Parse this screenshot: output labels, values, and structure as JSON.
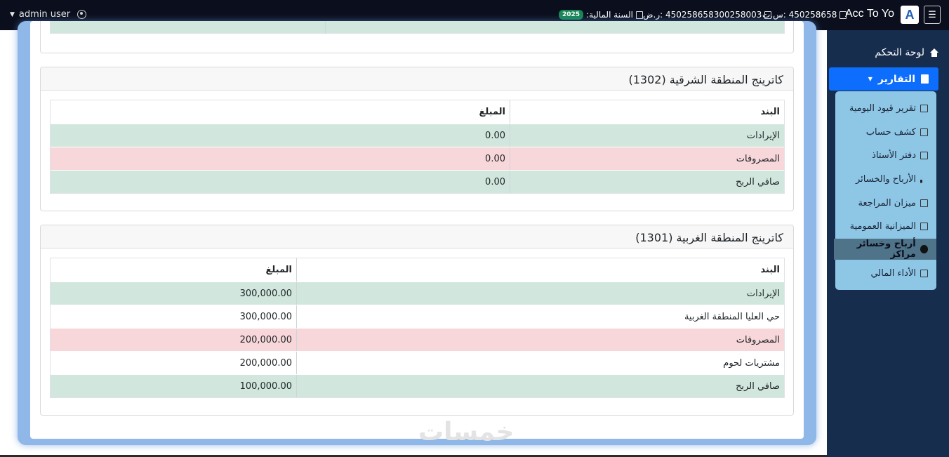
{
  "navbar": {
    "user": "admin user",
    "tax_number": "450258658 :س.ت",
    "commercial_register": "450258658300258003 :ر.ض",
    "fiscal_year_label": "السنة المالية:",
    "fiscal_year": "2025",
    "brand": "Acc To Yo",
    "logo_letter": "A",
    "menu_icon": "hamburger-icon"
  },
  "sidebar": {
    "dashboard": "لوحة التحكم",
    "reports": "التقارير",
    "items": [
      {
        "label": "تقرير قيود اليومية",
        "icon": "journal-icon"
      },
      {
        "label": "كشف حساب",
        "icon": "document-icon"
      },
      {
        "label": "دفتر الأستاذ",
        "icon": "book-icon"
      },
      {
        "label": "الأرباح والخسائر",
        "icon": "bar-chart-icon"
      },
      {
        "label": "ميزان المراجعة",
        "icon": "list-icon"
      },
      {
        "label": "الميزانية العمومية",
        "icon": "clipboard-chart-icon"
      },
      {
        "label": "أرباح وخسائر مراكز",
        "icon": "pie-chart-icon",
        "active": true
      },
      {
        "label": "الأداء المالي",
        "icon": "line-chart-icon"
      }
    ]
  },
  "cards": [
    {
      "title": "كاترينج المنطقة الشرقية (1302)",
      "headers": {
        "item": "البند",
        "amount": "المبلغ"
      },
      "rows": [
        {
          "item": "الإيرادات",
          "amount": "0.00",
          "type": "green"
        },
        {
          "item": "المصروفات",
          "amount": "0.00",
          "type": "red"
        },
        {
          "item": "صافي الربح",
          "amount": "0.00",
          "type": "green"
        }
      ]
    },
    {
      "title": "كاترينج المنطقة الغربية (1301)",
      "headers": {
        "item": "البند",
        "amount": "المبلغ"
      },
      "rows": [
        {
          "item": "الإيرادات",
          "amount": "300,000.00",
          "type": "green"
        },
        {
          "item": "حي العليا المنطقة الغربية",
          "amount": "300,000.00",
          "type": "white"
        },
        {
          "item": "المصروفات",
          "amount": "200,000.00",
          "type": "red"
        },
        {
          "item": "مشتريات لحوم",
          "amount": "200,000.00",
          "type": "white"
        },
        {
          "item": "صافي الربح",
          "amount": "100,000.00",
          "type": "green"
        }
      ]
    }
  ],
  "watermark": "خمسات",
  "colors": {
    "navbar": "#0b0f1d",
    "sidebar": "#172d4d",
    "accent": "#0d6efd",
    "success_row": "#d1e7dd",
    "danger_row": "#f8d7da",
    "badge": "#198754"
  }
}
